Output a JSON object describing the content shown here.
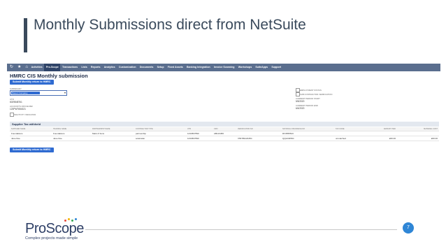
{
  "slide": {
    "title": "Monthly Submissions direct from NetSuite",
    "page_number": "7",
    "logo_text": "ProScope",
    "tagline": "Complex projects made simple",
    "accent_color": "#3a4a5c",
    "badge_color": "#2f86d6"
  },
  "netsuite": {
    "nav": {
      "icons": [
        "history-icon",
        "star-icon",
        "home-icon"
      ],
      "items": [
        "Activities",
        "Pro-Scope",
        "Transactions",
        "Lists",
        "Reports",
        "Analytics",
        "Customization",
        "Documents",
        "Setup",
        "Fixed Assets",
        "Banking Integration",
        "Invoice Scanning",
        "Workshops",
        "SuiteApps",
        "Support"
      ],
      "active_item": "Pro-Scope"
    },
    "page_title": "HMRC CIS Monthly submission",
    "submit_label": "Submit Monthly return to HMRC",
    "left_fields": {
      "subsidiary_label": "Subsidiary",
      "subsidiary_value": "Parent Company",
      "utr_label": "UTR",
      "utr_value": "6029848761",
      "office_ref_label": "Accounts Office Ref",
      "office_ref_value": "123PW7654321",
      "inactivity_label": "Inactivity Indicator"
    },
    "right_fields": {
      "employment_status_label": "Employment Status",
      "verification_label": "Sub Contractor Verification",
      "period_start_label": "Current Period Start",
      "period_start_value": "5/5/2020",
      "period_end_label": "Current Period End",
      "period_end_value": "6/4/2020"
    },
    "sublist_title": "Supplier Tax withheld",
    "table": {
      "headers": [
        "Supplier Name",
        "Trading Name",
        "Partnership Name",
        "Contractor Type",
        "UTR",
        "CRN",
        "Verification No",
        "National Insurance No",
        "Tax Code",
        "Amount Paid",
        "Material Cost"
      ],
      "rows": [
        [
          "Foundations",
          "Foundations",
          "Mark & Sons",
          "partnership",
          "1234567890",
          "AB123456",
          "",
          "RV3555543",
          "",
          "",
          ""
        ],
        [
          "Jane Doe",
          "Jane Doe",
          "",
          "soletrader",
          "1234567890",
          "",
          "V5678912345C",
          "QQ123456C",
          "unmatched",
          "£60.00",
          "£60.00"
        ]
      ]
    }
  }
}
